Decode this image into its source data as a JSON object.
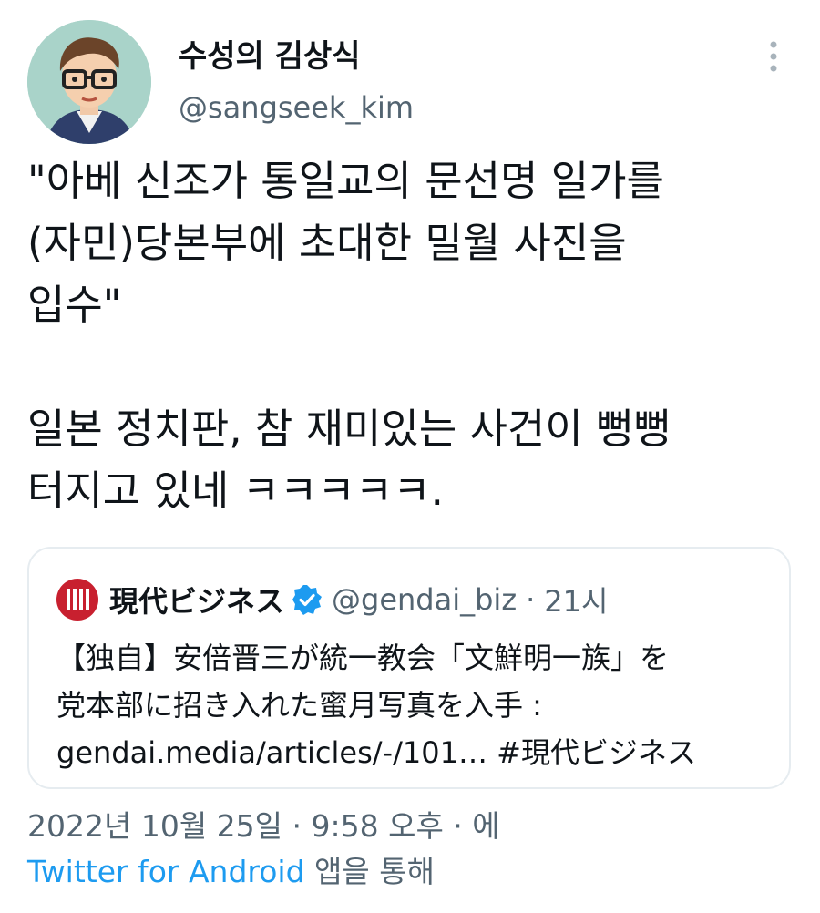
{
  "author": {
    "display_name": "수성의 김상식",
    "handle": "@sangseek_kim",
    "avatar_icon": "cartoon-avatar-icon",
    "avatar_bg": "#a9d3c9"
  },
  "more_icon": "more-vertical-icon",
  "tweet": {
    "lines": [
      "\"아베 신조가 통일교의 문선명 일가를",
      "(자민)당본부에 초대한 밀월 사진을",
      "입수\"",
      "일본 정치판, 참 재미있는 사건이 뻥뻥",
      "터지고 있네 ㅋㅋㅋㅋㅋ."
    ]
  },
  "quote": {
    "logo_icon": "gendai-logo-icon",
    "logo_color": "#c8202f",
    "name": "現代ビジネス",
    "verified_icon": "verified-badge-icon",
    "verified_color": "#1d9bf0",
    "handle": "@gendai_biz",
    "separator": "·",
    "time": "21시",
    "lines": [
      "【独自】安倍晋三が統一教会「文鮮明一族」を",
      "党本部に招き入れた蜜月写真を入手 :",
      "gendai.media/articles/-/101… #現代ビジネス"
    ]
  },
  "meta": {
    "timestamp": "2022년 10월 25일 · 9:58 오후 · 에",
    "source_link": "Twitter for Android",
    "source_suffix": " 앱을 통해"
  },
  "colors": {
    "text": "#0f1419",
    "secondary": "#536471",
    "link": "#1d9bf0",
    "border": "#e6ecf0"
  }
}
